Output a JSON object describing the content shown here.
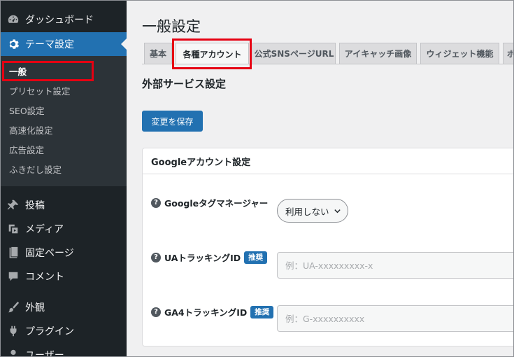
{
  "sidebar": {
    "dashboard": "ダッシュボード",
    "theme_settings": "テーマ設定",
    "submenu": [
      "一般",
      "プリセット設定",
      "SEO設定",
      "高速化設定",
      "広告設定",
      "ふきだし設定"
    ],
    "posts": "投稿",
    "media": "メディア",
    "pages": "固定ページ",
    "comments": "コメント",
    "appearance": "外観",
    "plugins": "プラグイン",
    "users": "ユーザー"
  },
  "page_title": "一般設定",
  "tabs": [
    "基本",
    "各種アカウント",
    "公式SNSページURL",
    "アイキャッチ画像",
    "ウィジェット機能",
    "ボ"
  ],
  "active_tab": "各種アカウント",
  "section_title": "外部サービス設定",
  "save_label": "変更を保存",
  "panel": {
    "title": "Googleアカウント設定",
    "gtm_label": "Googleタグマネージャー",
    "gtm_value": "利用しない",
    "ua_label": "UAトラッキングID",
    "ua_badge": "推奨",
    "ua_placeholder": "例：UA-xxxxxxxxx-x",
    "ga4_label": "GA4トラッキングID",
    "ga4_badge": "推奨",
    "ga4_placeholder": "例：G-xxxxxxxxxx"
  },
  "colors": {
    "sidebar_bg": "#1d2327",
    "submenu_bg": "#2c3338",
    "accent": "#2271b1",
    "highlight": "#e60012"
  },
  "icons": [
    "dashboard-icon",
    "gear-icon",
    "pin-icon",
    "media-icon",
    "page-icon",
    "comment-icon",
    "brush-icon",
    "plug-icon",
    "user-icon",
    "question-icon",
    "chevron-down-icon"
  ]
}
